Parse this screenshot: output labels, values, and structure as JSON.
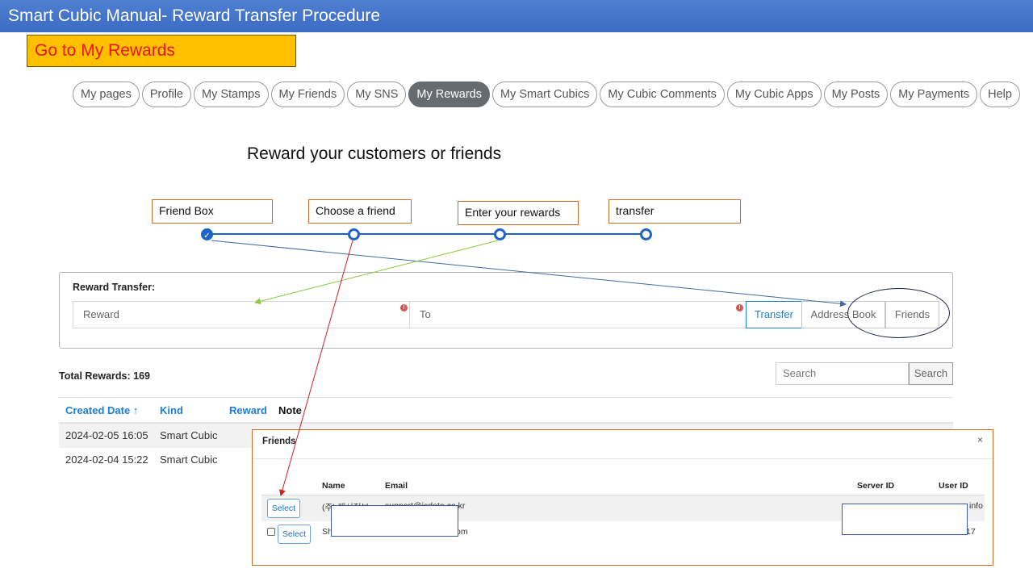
{
  "title": "Smart Cubic Manual- Reward Transfer Procedure",
  "callout_main": "Go to My Rewards",
  "nav": {
    "tabs": [
      "My pages",
      "Profile",
      "My Stamps",
      "My Friends",
      "My SNS",
      "My Rewards",
      "My Smart Cubics",
      "My Cubic Comments",
      "My Cubic Apps",
      "My Posts",
      "My Payments",
      "Help"
    ],
    "active": "My Rewards"
  },
  "heading": "Reward your customers or friends",
  "steps": {
    "labels": [
      "Friend Box",
      "Choose a friend",
      "Enter your rewards",
      "transfer"
    ],
    "completed": 1,
    "check_icon": "check-icon",
    "color": "#1c64c8"
  },
  "transfer": {
    "title": "Reward Transfer:",
    "reward_placeholder": "Reward",
    "to_placeholder": "To",
    "error_glyph": "!",
    "transfer_label": "Transfer",
    "address_book_label": "Address Book",
    "friends_label": "Friends"
  },
  "rewards": {
    "total_label": "Total Rewards: 169",
    "search_placeholder": "Search",
    "search_button": "Search",
    "columns": [
      "Created Date ↑",
      "Kind",
      "Reward",
      "Note"
    ],
    "rows": [
      {
        "date": "2024-02-05 16:05",
        "kind": "Smart Cubic"
      },
      {
        "date": "2024-02-04 15:22",
        "kind": "Smart Cubic"
      }
    ]
  },
  "friends_modal": {
    "title": "Friends",
    "close": "×",
    "columns": [
      "Name",
      "Email",
      "Server ID",
      "User ID"
    ],
    "select_label": "Select",
    "rows": [
      {
        "name": "(주) 재시정보",
        "email": "support@isdata.co.kr",
        "user_id": "info"
      },
      {
        "name": "Sh",
        "email": "om",
        "user_id": "17"
      }
    ]
  },
  "annotation_colors": {
    "blue": "#3a6aa8",
    "green": "#8dc63f",
    "red": "#d11e1e",
    "callout_border": "#c86b2a",
    "highlight": "#ffc000"
  }
}
